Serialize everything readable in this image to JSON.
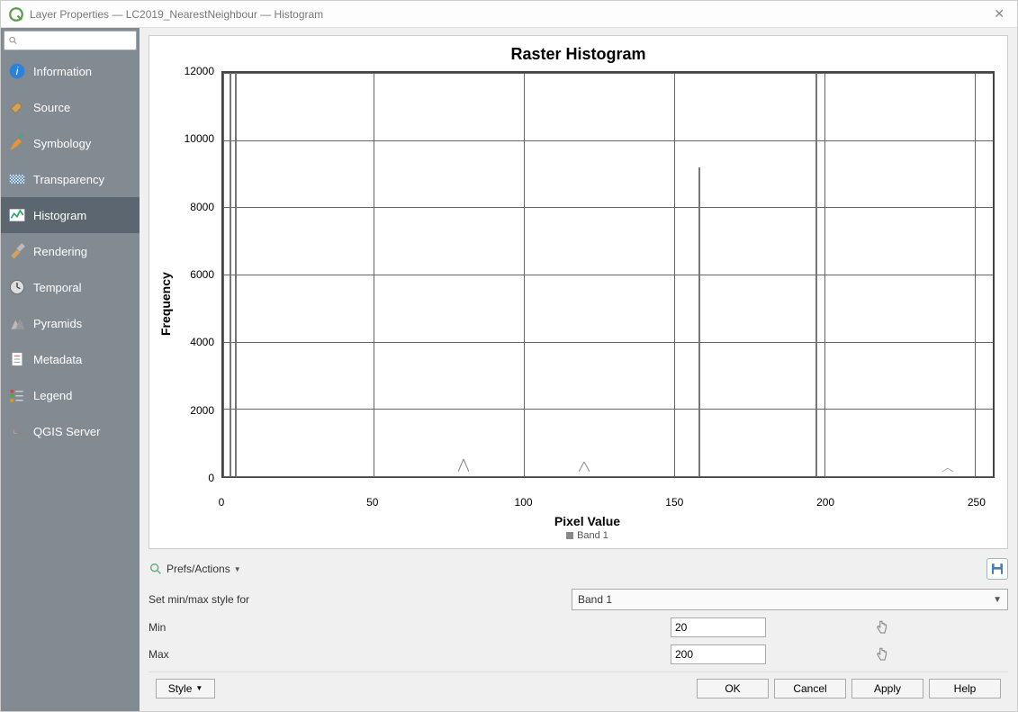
{
  "window": {
    "title": "Layer Properties — LC2019_NearestNeighbour — Histogram"
  },
  "search": {
    "placeholder": ""
  },
  "sidebar": {
    "items": [
      {
        "label": "Information"
      },
      {
        "label": "Source"
      },
      {
        "label": "Symbology"
      },
      {
        "label": "Transparency"
      },
      {
        "label": "Histogram"
      },
      {
        "label": "Rendering"
      },
      {
        "label": "Temporal"
      },
      {
        "label": "Pyramids"
      },
      {
        "label": "Metadata"
      },
      {
        "label": "Legend"
      },
      {
        "label": "QGIS Server"
      }
    ],
    "active_index": 4
  },
  "chart_data": {
    "type": "line",
    "title": "Raster Histogram",
    "xlabel": "Pixel Value",
    "ylabel": "Frequency",
    "xlim": [
      0,
      256
    ],
    "ylim": [
      0,
      12000
    ],
    "xticks": [
      0,
      50,
      100,
      150,
      200,
      250
    ],
    "yticks": [
      0,
      2000,
      4000,
      6000,
      8000,
      10000,
      12000
    ],
    "series": [
      {
        "name": "Band 1",
        "peaks": [
          {
            "x": 2,
            "y": 12000
          },
          {
            "x": 4,
            "y": 12000
          },
          {
            "x": 80,
            "y": 450
          },
          {
            "x": 120,
            "y": 350
          },
          {
            "x": 158,
            "y": 9200
          },
          {
            "x": 197,
            "y": 12000
          },
          {
            "x": 241,
            "y": 120
          }
        ]
      }
    ],
    "legend": "Band 1"
  },
  "controls": {
    "prefs_label": "Prefs/Actions",
    "set_minmax_label": "Set min/max style for",
    "band_selected": "Band 1",
    "min_label": "Min",
    "min_value": "20",
    "max_label": "Max",
    "max_value": "200"
  },
  "footer": {
    "style": "Style",
    "ok": "OK",
    "cancel": "Cancel",
    "apply": "Apply",
    "help": "Help"
  }
}
